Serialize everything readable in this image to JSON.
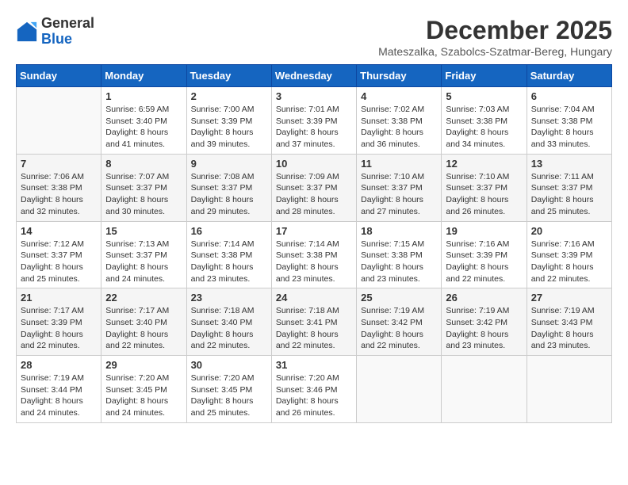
{
  "logo": {
    "general": "General",
    "blue": "Blue"
  },
  "header": {
    "month": "December 2025",
    "location": "Mateszalka, Szabolcs-Szatmar-Bereg, Hungary"
  },
  "weekdays": [
    "Sunday",
    "Monday",
    "Tuesday",
    "Wednesday",
    "Thursday",
    "Friday",
    "Saturday"
  ],
  "weeks": [
    [
      {
        "day": "",
        "info": ""
      },
      {
        "day": "1",
        "info": "Sunrise: 6:59 AM\nSunset: 3:40 PM\nDaylight: 8 hours\nand 41 minutes."
      },
      {
        "day": "2",
        "info": "Sunrise: 7:00 AM\nSunset: 3:39 PM\nDaylight: 8 hours\nand 39 minutes."
      },
      {
        "day": "3",
        "info": "Sunrise: 7:01 AM\nSunset: 3:39 PM\nDaylight: 8 hours\nand 37 minutes."
      },
      {
        "day": "4",
        "info": "Sunrise: 7:02 AM\nSunset: 3:38 PM\nDaylight: 8 hours\nand 36 minutes."
      },
      {
        "day": "5",
        "info": "Sunrise: 7:03 AM\nSunset: 3:38 PM\nDaylight: 8 hours\nand 34 minutes."
      },
      {
        "day": "6",
        "info": "Sunrise: 7:04 AM\nSunset: 3:38 PM\nDaylight: 8 hours\nand 33 minutes."
      }
    ],
    [
      {
        "day": "7",
        "info": "Sunrise: 7:06 AM\nSunset: 3:38 PM\nDaylight: 8 hours\nand 32 minutes."
      },
      {
        "day": "8",
        "info": "Sunrise: 7:07 AM\nSunset: 3:37 PM\nDaylight: 8 hours\nand 30 minutes."
      },
      {
        "day": "9",
        "info": "Sunrise: 7:08 AM\nSunset: 3:37 PM\nDaylight: 8 hours\nand 29 minutes."
      },
      {
        "day": "10",
        "info": "Sunrise: 7:09 AM\nSunset: 3:37 PM\nDaylight: 8 hours\nand 28 minutes."
      },
      {
        "day": "11",
        "info": "Sunrise: 7:10 AM\nSunset: 3:37 PM\nDaylight: 8 hours\nand 27 minutes."
      },
      {
        "day": "12",
        "info": "Sunrise: 7:10 AM\nSunset: 3:37 PM\nDaylight: 8 hours\nand 26 minutes."
      },
      {
        "day": "13",
        "info": "Sunrise: 7:11 AM\nSunset: 3:37 PM\nDaylight: 8 hours\nand 25 minutes."
      }
    ],
    [
      {
        "day": "14",
        "info": "Sunrise: 7:12 AM\nSunset: 3:37 PM\nDaylight: 8 hours\nand 25 minutes."
      },
      {
        "day": "15",
        "info": "Sunrise: 7:13 AM\nSunset: 3:37 PM\nDaylight: 8 hours\nand 24 minutes."
      },
      {
        "day": "16",
        "info": "Sunrise: 7:14 AM\nSunset: 3:38 PM\nDaylight: 8 hours\nand 23 minutes."
      },
      {
        "day": "17",
        "info": "Sunrise: 7:14 AM\nSunset: 3:38 PM\nDaylight: 8 hours\nand 23 minutes."
      },
      {
        "day": "18",
        "info": "Sunrise: 7:15 AM\nSunset: 3:38 PM\nDaylight: 8 hours\nand 23 minutes."
      },
      {
        "day": "19",
        "info": "Sunrise: 7:16 AM\nSunset: 3:39 PM\nDaylight: 8 hours\nand 22 minutes."
      },
      {
        "day": "20",
        "info": "Sunrise: 7:16 AM\nSunset: 3:39 PM\nDaylight: 8 hours\nand 22 minutes."
      }
    ],
    [
      {
        "day": "21",
        "info": "Sunrise: 7:17 AM\nSunset: 3:39 PM\nDaylight: 8 hours\nand 22 minutes."
      },
      {
        "day": "22",
        "info": "Sunrise: 7:17 AM\nSunset: 3:40 PM\nDaylight: 8 hours\nand 22 minutes."
      },
      {
        "day": "23",
        "info": "Sunrise: 7:18 AM\nSunset: 3:40 PM\nDaylight: 8 hours\nand 22 minutes."
      },
      {
        "day": "24",
        "info": "Sunrise: 7:18 AM\nSunset: 3:41 PM\nDaylight: 8 hours\nand 22 minutes."
      },
      {
        "day": "25",
        "info": "Sunrise: 7:19 AM\nSunset: 3:42 PM\nDaylight: 8 hours\nand 22 minutes."
      },
      {
        "day": "26",
        "info": "Sunrise: 7:19 AM\nSunset: 3:42 PM\nDaylight: 8 hours\nand 23 minutes."
      },
      {
        "day": "27",
        "info": "Sunrise: 7:19 AM\nSunset: 3:43 PM\nDaylight: 8 hours\nand 23 minutes."
      }
    ],
    [
      {
        "day": "28",
        "info": "Sunrise: 7:19 AM\nSunset: 3:44 PM\nDaylight: 8 hours\nand 24 minutes."
      },
      {
        "day": "29",
        "info": "Sunrise: 7:20 AM\nSunset: 3:45 PM\nDaylight: 8 hours\nand 24 minutes."
      },
      {
        "day": "30",
        "info": "Sunrise: 7:20 AM\nSunset: 3:45 PM\nDaylight: 8 hours\nand 25 minutes."
      },
      {
        "day": "31",
        "info": "Sunrise: 7:20 AM\nSunset: 3:46 PM\nDaylight: 8 hours\nand 26 minutes."
      },
      {
        "day": "",
        "info": ""
      },
      {
        "day": "",
        "info": ""
      },
      {
        "day": "",
        "info": ""
      }
    ]
  ]
}
